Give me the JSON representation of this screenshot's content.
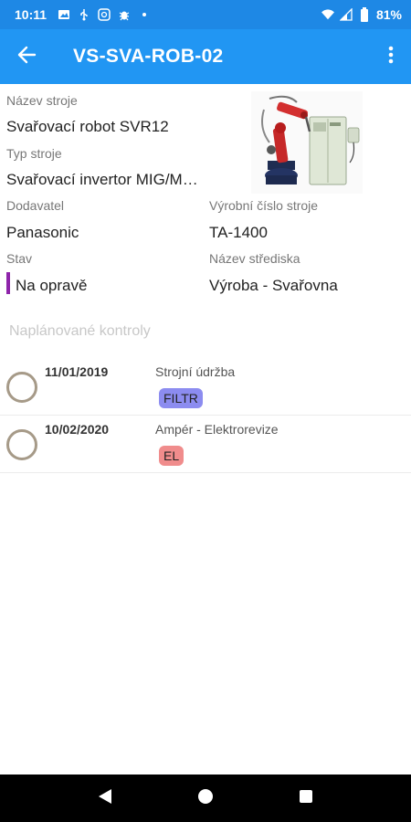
{
  "status_bar": {
    "time": "10:11",
    "battery": "81%",
    "icons": [
      "image-icon",
      "usb-icon",
      "cast-icon",
      "bug-icon",
      "dot-icon",
      "wifi-icon",
      "signal-icon",
      "battery-icon"
    ]
  },
  "app_bar": {
    "title": "VS-SVA-ROB-02",
    "back_icon": "arrow-back-icon",
    "menu_icon": "more-vert-icon"
  },
  "machine": {
    "name_label": "Název stroje",
    "name_value": "Svařovací robot SVR12",
    "type_label": "Typ stroje",
    "type_value": "Svařovací invertor MIG/M…",
    "supplier_label": "Dodavatel",
    "supplier_value": "Panasonic",
    "serial_label": "Výrobní číslo stroje",
    "serial_value": "TA-1400",
    "state_label": "Stav",
    "state_value": "Na opravě",
    "state_color": "#8e24aa",
    "center_label": "Název střediska",
    "center_value": "Výroba - Svařovna"
  },
  "inspections": {
    "heading": "Naplánované kontroly",
    "items": [
      {
        "date": "11/01/2019",
        "type": "Strojní údržba",
        "tag": "FILTR",
        "tag_color": "#8c8cf0"
      },
      {
        "date": "10/02/2020",
        "type": "Ampér - Elektrorevize",
        "tag": "EL",
        "tag_color": "#f08c8c"
      }
    ]
  },
  "nav": {
    "back": "nav-back-icon",
    "home": "nav-home-icon",
    "recents": "nav-recents-icon"
  },
  "colors": {
    "status_bar": "#1e88e5",
    "app_bar": "#2196f3"
  }
}
